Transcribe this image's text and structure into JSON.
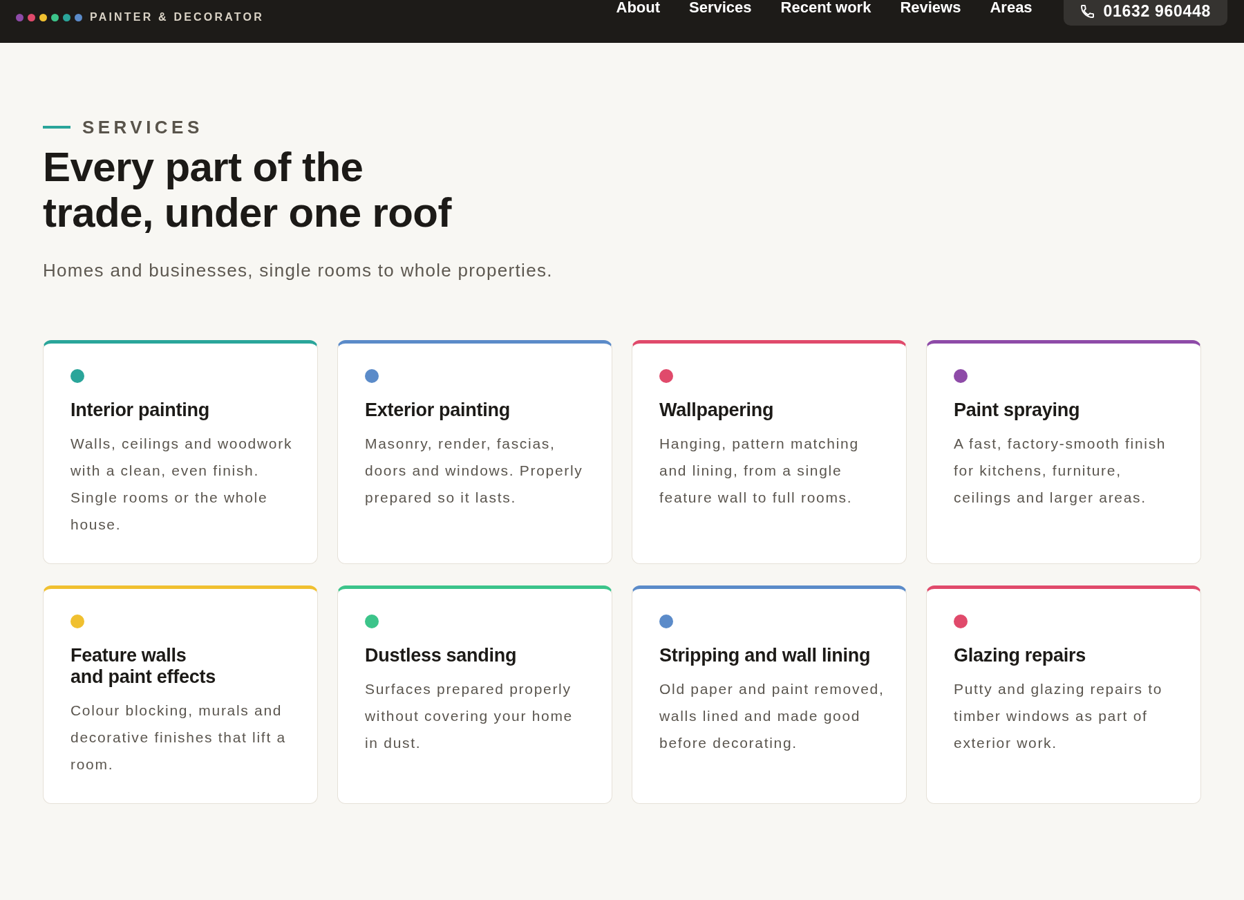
{
  "header": {
    "logo": {
      "dots": [
        {
          "color": "#8e4ba8"
        },
        {
          "color": "#e04a6b"
        },
        {
          "color": "#f0c030"
        },
        {
          "color": "#3cc48a"
        },
        {
          "color": "#2aa59a"
        },
        {
          "color": "#5b8bc9"
        }
      ],
      "text": "PAINTER & DECORATOR"
    },
    "nav": [
      "About",
      "Services",
      "Recent work",
      "Reviews",
      "Areas"
    ],
    "phone": "01632 960448"
  },
  "services": {
    "eyebrow": "SERVICES",
    "heading": "Every part of the trade, under one roof",
    "subtitle": "Homes and businesses, single rooms to whole properties.",
    "cards": [
      {
        "color": "#2aa59a",
        "title_lines": [
          "Interior painting"
        ],
        "description": "Walls, ceilings and woodwork with a clean, even finish. Single rooms or the whole house."
      },
      {
        "color": "#5b8bc9",
        "title_lines": [
          "Exterior painting"
        ],
        "description": "Masonry, render, fascias, doors and windows. Properly prepared so it lasts."
      },
      {
        "color": "#e04a6b",
        "title_lines": [
          "Wallpapering"
        ],
        "description": "Hanging, pattern matching and lining, from a single feature wall to full rooms."
      },
      {
        "color": "#8e4ba8",
        "title_lines": [
          "Paint spraying"
        ],
        "description": "A fast, factory-smooth finish for kitchens, furniture, ceilings and larger areas."
      },
      {
        "color": "#f0c030",
        "title_lines": [
          "Feature walls",
          "and paint effects"
        ],
        "description": "Colour blocking, murals and decorative finishes that lift a room."
      },
      {
        "color": "#3cc48a",
        "title_lines": [
          "Dustless sanding"
        ],
        "description": "Surfaces prepared properly without covering your home in dust."
      },
      {
        "color": "#5b8bc9",
        "title_lines": [
          "Stripping and wall lining"
        ],
        "description": "Old paper and paint removed, walls lined and made good before decorating."
      },
      {
        "color": "#e04a6b",
        "title_lines": [
          "Glazing repairs"
        ],
        "description": "Putty and glazing repairs to timber windows as part of exterior work."
      }
    ]
  }
}
